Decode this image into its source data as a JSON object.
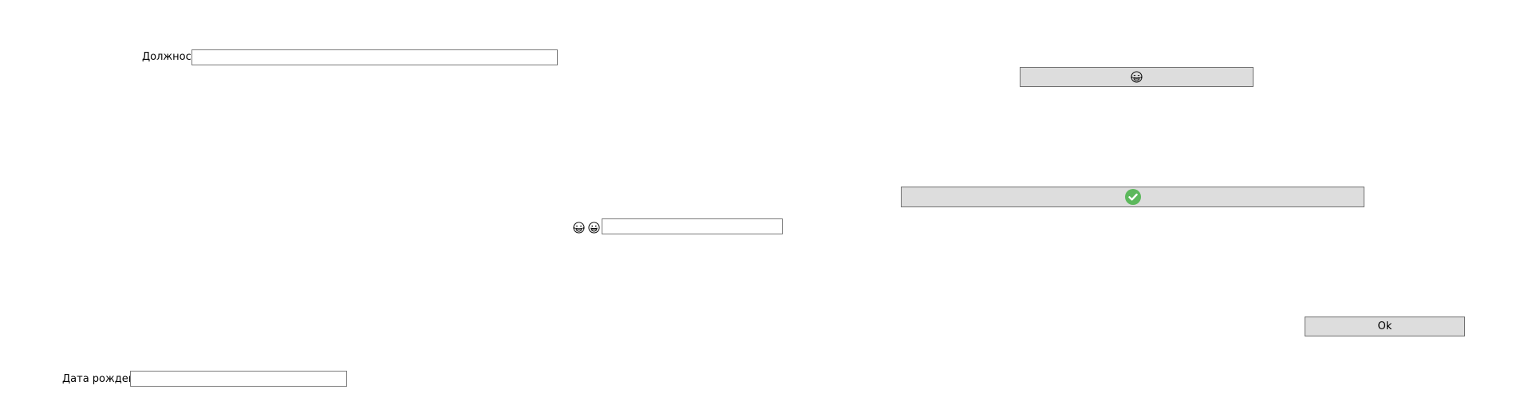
{
  "form": {
    "position_label": "Должность",
    "position_value": "",
    "birthdate_label": "Дата рождения",
    "birthdate_value": "",
    "emoji_field_value": "",
    "ok_label": "Ok"
  },
  "icons": {
    "emoji_button_icon": "grinning-tears-face-icon",
    "emoji_label_icon_1": "grinning-tears-face-icon",
    "emoji_label_icon_2": "grinning-face-icon",
    "check_button_icon": "check-circle-icon"
  },
  "colors": {
    "button_bg": "#dddddd",
    "button_border": "#707070",
    "textbox_border": "#7a7a7a",
    "check_green": "#5cb85c"
  }
}
